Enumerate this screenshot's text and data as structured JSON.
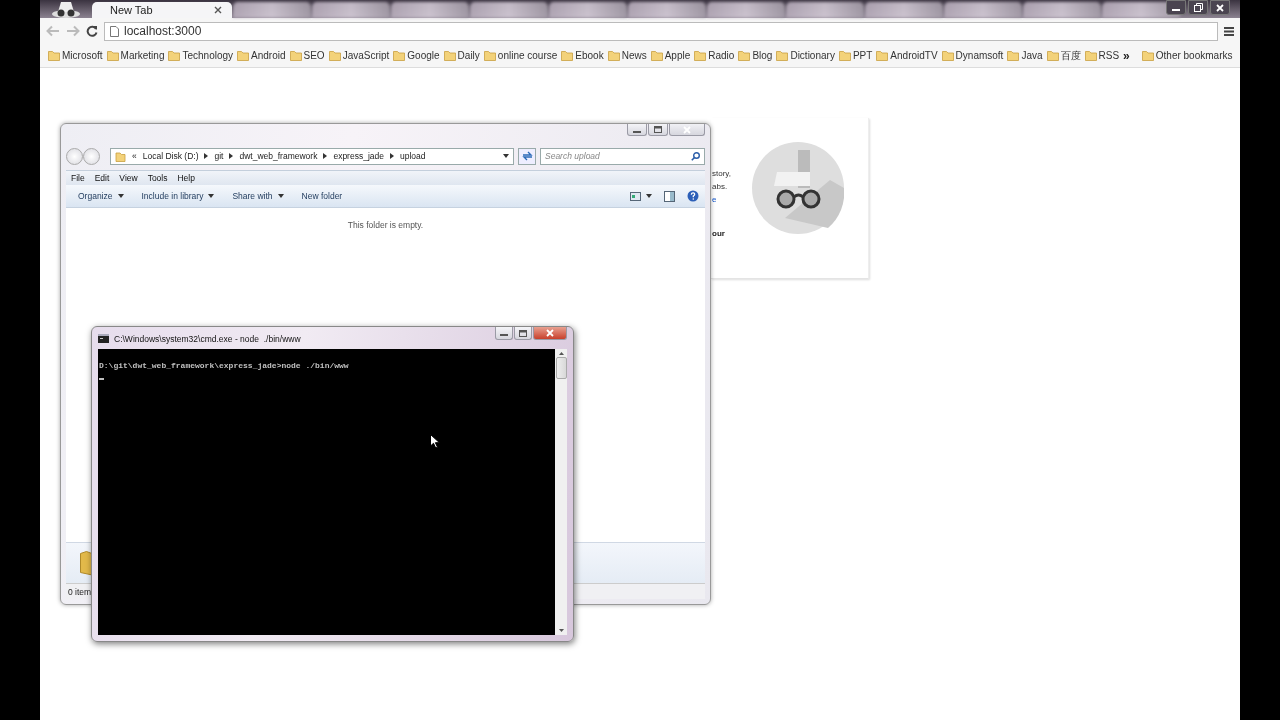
{
  "browser": {
    "tabs": [
      {
        "label": "New Tab",
        "selected": true
      },
      {
        "selected": false
      },
      {
        "selected": false
      },
      {
        "selected": false
      },
      {
        "selected": false
      },
      {
        "selected": false
      },
      {
        "selected": false
      },
      {
        "selected": false
      },
      {
        "selected": false
      },
      {
        "selected": false
      },
      {
        "selected": false
      },
      {
        "selected": false
      },
      {
        "selected": false
      }
    ],
    "address": "localhost:3000",
    "bookmarks": [
      "Microsoft",
      "Marketing",
      "Technology",
      "Android",
      "SEO",
      "JavaScript",
      "Google",
      "Daily",
      "online course",
      "Ebook",
      "News",
      "Apple",
      "Radio",
      "Blog",
      "Dictionary",
      "PPT",
      "AndroidTV",
      "Dynamsoft",
      "Java",
      "百度",
      "RSS"
    ],
    "bookmarks_overflow": "»",
    "other_bookmarks": "Other bookmarks"
  },
  "incognito_card": {
    "fragments": [
      {
        "text": "story,",
        "kind": "plain"
      },
      {
        "text": "abs.",
        "kind": "plain"
      },
      {
        "text": "e",
        "kind": "link"
      },
      {
        "text": "our",
        "kind": "bold"
      }
    ]
  },
  "explorer": {
    "path_prefix": "«",
    "path": [
      "Local Disk (D:)",
      "git",
      "dwt_web_framework",
      "express_jade",
      "upload"
    ],
    "search": {
      "placeholder": "Search upload"
    },
    "menu": [
      "File",
      "Edit",
      "View",
      "Tools",
      "Help"
    ],
    "toolbar": [
      {
        "label": "Organize",
        "dropdown": true
      },
      {
        "label": "Include in library",
        "dropdown": true
      },
      {
        "label": "Share with",
        "dropdown": true
      },
      {
        "label": "New folder",
        "dropdown": false
      }
    ],
    "empty_message": "This folder is empty.",
    "status": "0 item"
  },
  "cmd": {
    "title": "C:\\Windows\\system32\\cmd.exe - node  ./bin/www",
    "lines": [
      "D:\\git\\dwt_web_framework\\express_jade>node ./bin/www"
    ],
    "cursor": true
  }
}
